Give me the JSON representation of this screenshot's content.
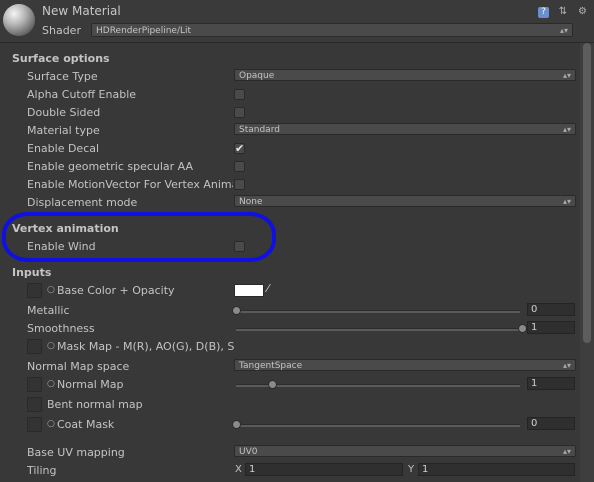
{
  "header": {
    "material_name": "New Material",
    "shader_label": "Shader",
    "shader_value": "HDRenderPipeline/Lit",
    "icons": [
      "book-icon",
      "preset-icon",
      "gear-icon"
    ]
  },
  "surface_options": {
    "title": "Surface options",
    "surface_type": {
      "label": "Surface Type",
      "value": "Opaque"
    },
    "alpha_cutoff": {
      "label": "Alpha Cutoff Enable",
      "checked": false
    },
    "double_sided": {
      "label": "Double Sided",
      "checked": false
    },
    "material_type": {
      "label": "Material type",
      "value": "Standard"
    },
    "enable_decal": {
      "label": "Enable Decal",
      "checked": true
    },
    "geometric_aa": {
      "label": "Enable geometric specular AA",
      "checked": false
    },
    "motion_vector": {
      "label": "Enable MotionVector For Vertex Animation",
      "checked": false
    },
    "displacement": {
      "label": "Displacement mode",
      "value": "None"
    }
  },
  "vertex_animation": {
    "title": "Vertex animation",
    "enable_wind": {
      "label": "Enable Wind",
      "checked": false
    }
  },
  "inputs": {
    "title": "Inputs",
    "base_color": {
      "label": "Base Color + Opacity",
      "color": "#ffffff"
    },
    "metallic": {
      "label": "Metallic",
      "value": "0",
      "fraction": 0
    },
    "smoothness": {
      "label": "Smoothness",
      "value": "1",
      "fraction": 1
    },
    "mask_map": {
      "label": "Mask Map - M(R), AO(G), D(B), S"
    },
    "normal_map_space": {
      "label": "Normal Map space",
      "value": "TangentSpace"
    },
    "normal_map": {
      "label": "Normal Map",
      "value": "1",
      "fraction": 0.125
    },
    "bent_normal_map": {
      "label": "Bent normal map"
    },
    "coat_mask": {
      "label": "Coat Mask",
      "value": "0",
      "fraction": 0
    },
    "base_uv_mapping": {
      "label": "Base UV mapping",
      "value": "UV0"
    },
    "tiling": {
      "label": "Tiling",
      "x_label": "X",
      "x": "1",
      "y_label": "Y",
      "y": "1"
    }
  },
  "colors": {
    "annotation": "#1010e0",
    "background": "#383838"
  }
}
